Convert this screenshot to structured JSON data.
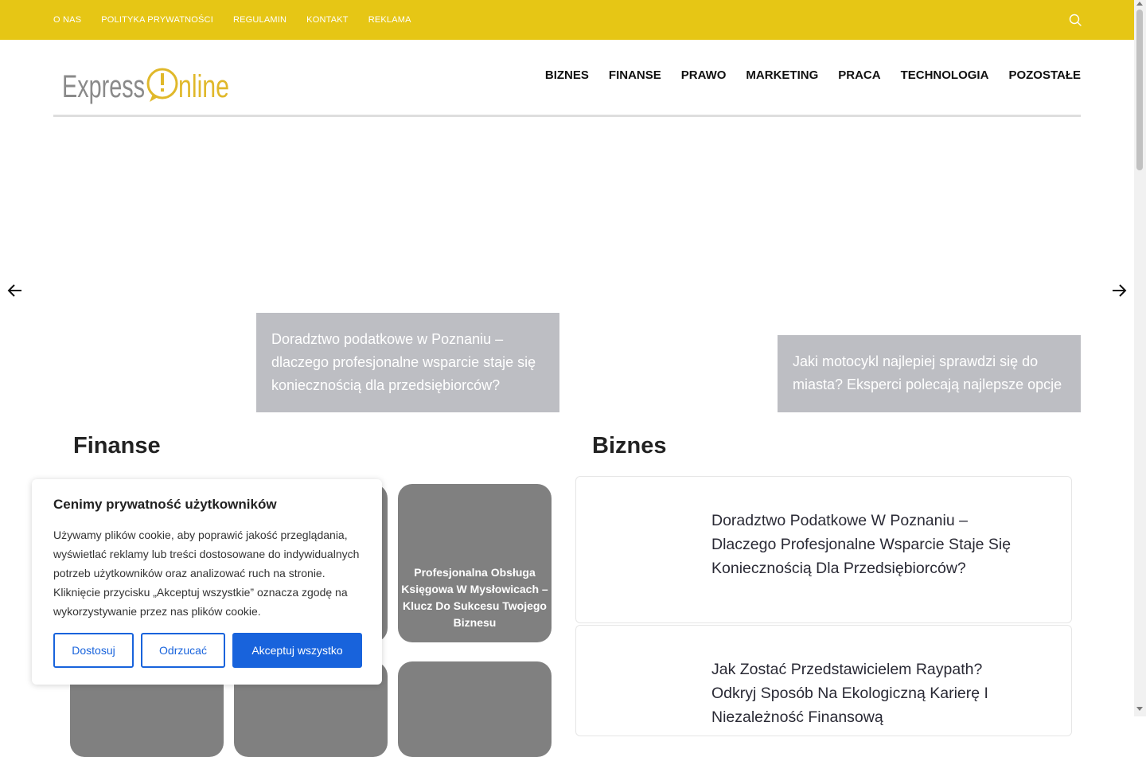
{
  "topbar": {
    "links": [
      "O NAS",
      "POLITYKA PRYWATNOŚCI",
      "REGULAMIN",
      "KONTAKT",
      "REKLAMA"
    ],
    "background": "#e6c615"
  },
  "header": {
    "logo_text": "ExpressOnline",
    "nav": [
      "BIZNES",
      "FINANSE",
      "PRAWO",
      "MARKETING",
      "PRACA",
      "TECHNOLOGIA",
      "POZOSTAŁE"
    ]
  },
  "slider": {
    "slides": [
      "Doradztwo podatkowe w Poznaniu – dlaczego profesjonalne wsparcie staje się koniecznością dla przedsiębiorców?",
      "Jaki motocykl najlepiej sprawdzi się do miasta? Eksperci polecają najlepsze opcje"
    ]
  },
  "sections": {
    "finanse": {
      "title": "Finanse",
      "tiles": [
        "Profesjonalna Obsługa Księgowa W Mysłowicach – Klucz Do Sukcesu Twojego Biznesu"
      ]
    },
    "biznes": {
      "title": "Biznes",
      "articles": [
        "Doradztwo Podatkowe W Poznaniu – Dlaczego Profesjonalne Wsparcie Staje Się Koniecznością Dla Przedsiębiorców?",
        "Jak Zostać Przedstawicielem Raypath? Odkryj Sposób Na Ekologiczną Karierę I Niezależność Finansową"
      ]
    }
  },
  "cookie": {
    "title": "Cenimy prywatność użytkowników",
    "text": "Używamy plików cookie, aby poprawić jakość przeglądania, wyświetlać reklamy lub treści dostosowane do indywidualnych potrzeb użytkowników oraz analizować ruch na stronie. Kliknięcie przycisku „Akceptuj wszystkie” oznacza zgodę na wykorzystywanie przez nas plików cookie.",
    "buttons": {
      "customize": "Dostosuj",
      "reject": "Odrzucać",
      "accept": "Akceptuj wszystko"
    },
    "accent": "#1863dc"
  }
}
